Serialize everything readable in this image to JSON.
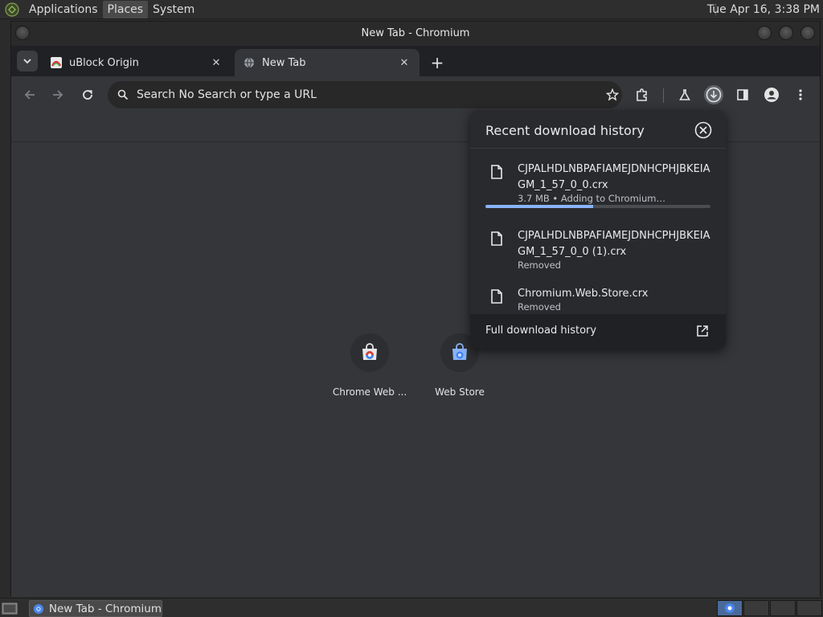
{
  "top_panel": {
    "menus": [
      "Applications",
      "Places",
      "System"
    ],
    "clock": "Tue Apr 16,  3:38 PM"
  },
  "window": {
    "title": "New Tab - Chromium"
  },
  "tabs": [
    {
      "label": "uBlock Origin",
      "icon": "ublock-icon",
      "active": false
    },
    {
      "label": "New Tab",
      "icon": "globe-icon",
      "active": true
    }
  ],
  "toolbar": {
    "omnibox_text": "Search No Search or type a URL"
  },
  "shortcuts": [
    {
      "label": "Chrome Web ..."
    },
    {
      "label": "Web Store"
    }
  ],
  "download_bubble": {
    "title": "Recent download history",
    "items": [
      {
        "name": "CJPALHDLNBPAFIAMEJDNHCPHJBKEIAGM_1_57_0_0.crx",
        "status": "3.7 MB • Adding to Chromium…",
        "progress": 0.48
      },
      {
        "name": "CJPALHDLNBPAFIAMEJDNHCPHJBKEIAGM_1_57_0_0 (1).crx",
        "status": "Removed"
      },
      {
        "name": "Chromium.Web.Store.crx",
        "status": "Removed"
      }
    ],
    "footer_label": "Full download history"
  },
  "taskbar": {
    "window_button_label": "New Tab - Chromium"
  },
  "colors": {
    "accent": "#8ab4f8",
    "window_bg": "#35363a",
    "panel_bg": "#2e2e2e"
  }
}
